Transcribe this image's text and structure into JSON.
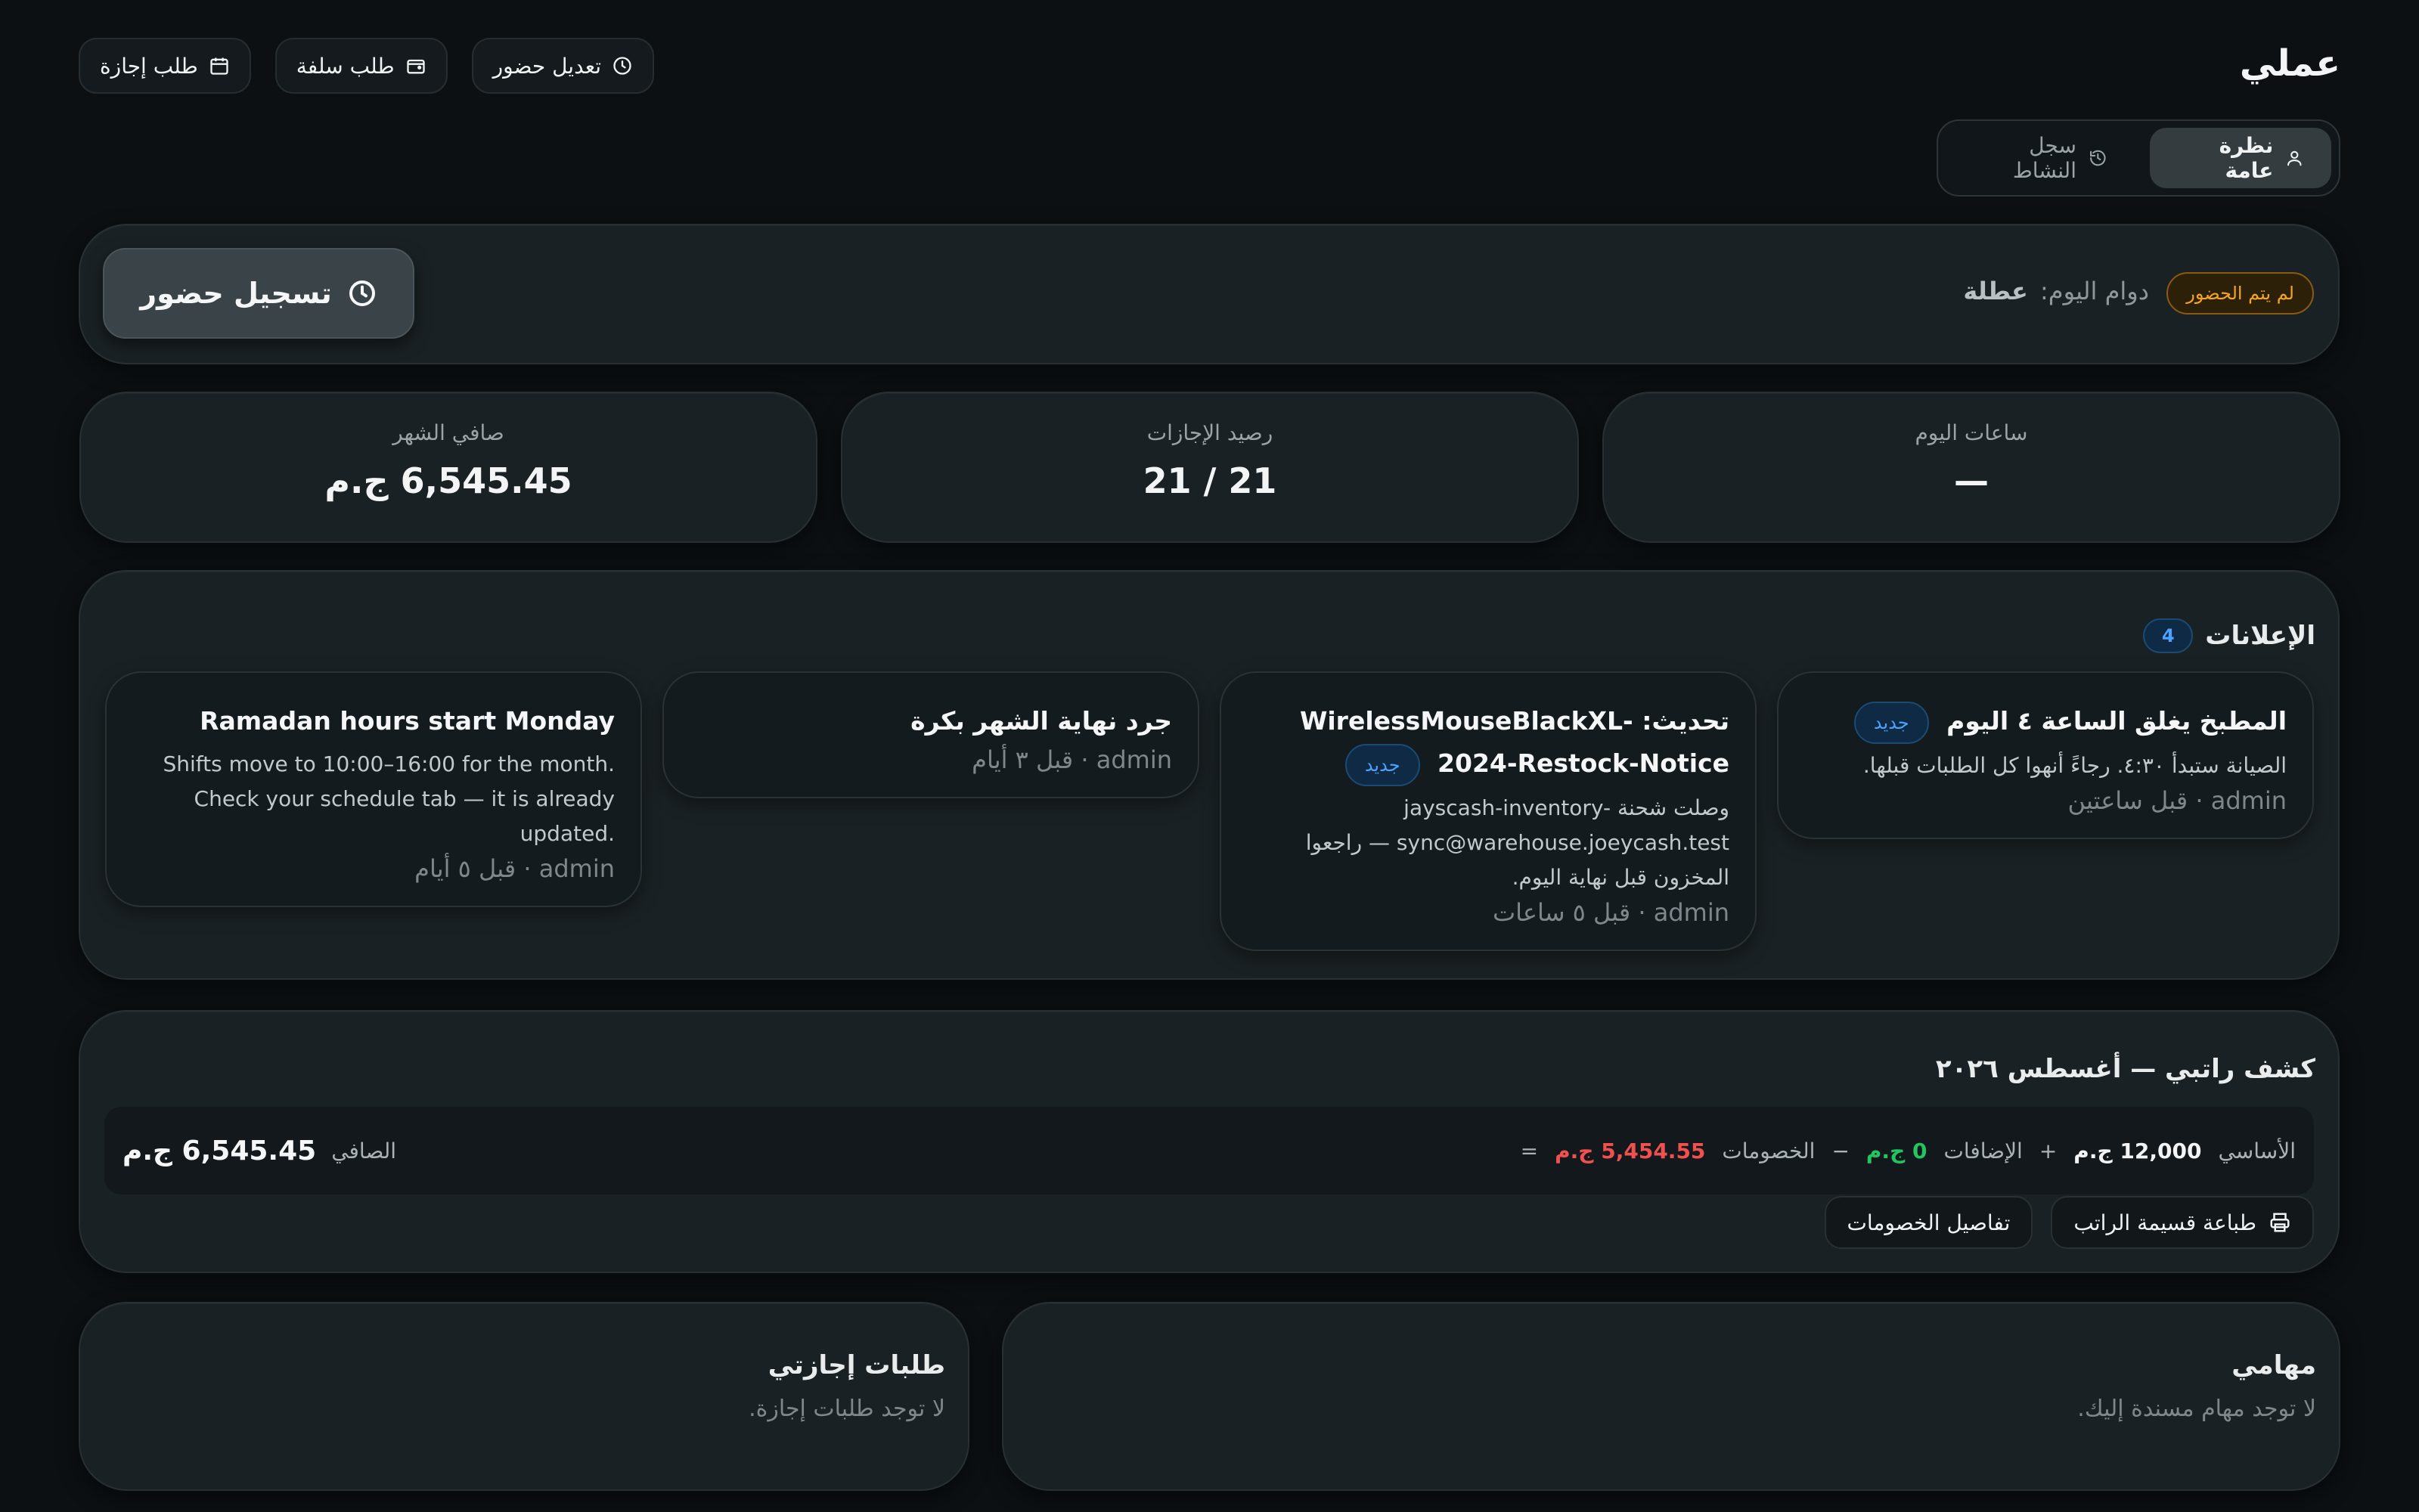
{
  "header": {
    "title": "عملي",
    "tabs": [
      {
        "label": "نظرة عامة",
        "icon": "user-icon",
        "active": true
      },
      {
        "label": "سجل النشاط",
        "icon": "history-icon",
        "active": false
      }
    ],
    "quick_actions": [
      {
        "label": "طلب إجازة",
        "icon": "calendar-icon"
      },
      {
        "label": "طلب سلفة",
        "icon": "wallet-icon"
      },
      {
        "label": "تعديل حضور",
        "icon": "clock-icon"
      }
    ]
  },
  "attendance": {
    "status_badge": "لم يتم الحضور",
    "shift_label": "دوام اليوم:",
    "shift_value": "عطلة",
    "checkin_label": "تسجيل حضور"
  },
  "stats": [
    {
      "label": "ساعات اليوم",
      "value": "—"
    },
    {
      "label": "رصيد الإجازات",
      "value": "21 / 21"
    },
    {
      "label": "صافي الشهر",
      "value": "6,545.45 ج.م"
    }
  ],
  "announcements": {
    "title": "الإعلانات",
    "count": "4",
    "items": [
      {
        "title": "المطبخ يغلق الساعة ٤ اليوم",
        "new_label": "جديد",
        "body": "الصيانة ستبدأ ٤:٣٠. رجاءً أنهوا كل الطلبات قبلها.",
        "meta": "admin · قبل ساعتين"
      },
      {
        "title": "تحديث: WirelessMouseBlackXL-2024-Restock-Notice",
        "new_label": "جديد",
        "body": "وصلت شحنة jayscash-inventory-sync@warehouse.joeycash.test — راجعوا المخزون قبل نهاية اليوم.",
        "meta": "admin · قبل ٥ ساعات"
      },
      {
        "title": "جرد نهاية الشهر بكرة",
        "meta": "admin · قبل ٣ أيام"
      },
      {
        "title": "Ramadan hours start Monday",
        "body": "Shifts move to 10:00–16:00 for the month. Check your schedule tab — it is already updated.",
        "meta": "admin · قبل ٥ أيام"
      }
    ]
  },
  "payslip": {
    "title": "كشف راتبي — أغسطس ٢٠٢٦",
    "base_label": "الأساسي",
    "base_value": "12,000 ج.م",
    "plus": "+",
    "additions_label": "الإضافات",
    "additions_value": "0 ج.م",
    "minus": "−",
    "deductions_label": "الخصومات",
    "deductions_value": "5,454.55 ج.م",
    "equals": "=",
    "net_label": "الصافي",
    "net_value": "6,545.45 ج.م",
    "print_label": "طباعة قسيمة الراتب",
    "deductions_details_label": "تفاصيل الخصومات"
  },
  "tasks": {
    "title": "مهامي",
    "empty": "لا توجد مهام مسندة إليك."
  },
  "leave_requests": {
    "title": "طلبات إجازتي",
    "empty": "لا توجد طلبات إجازة."
  },
  "colors": {
    "background": "#0c1013",
    "card": "#1a2124",
    "warning": "#f5a524",
    "info": "#4ea1ff",
    "positive": "#22c55e",
    "negative": "#f0514f"
  }
}
